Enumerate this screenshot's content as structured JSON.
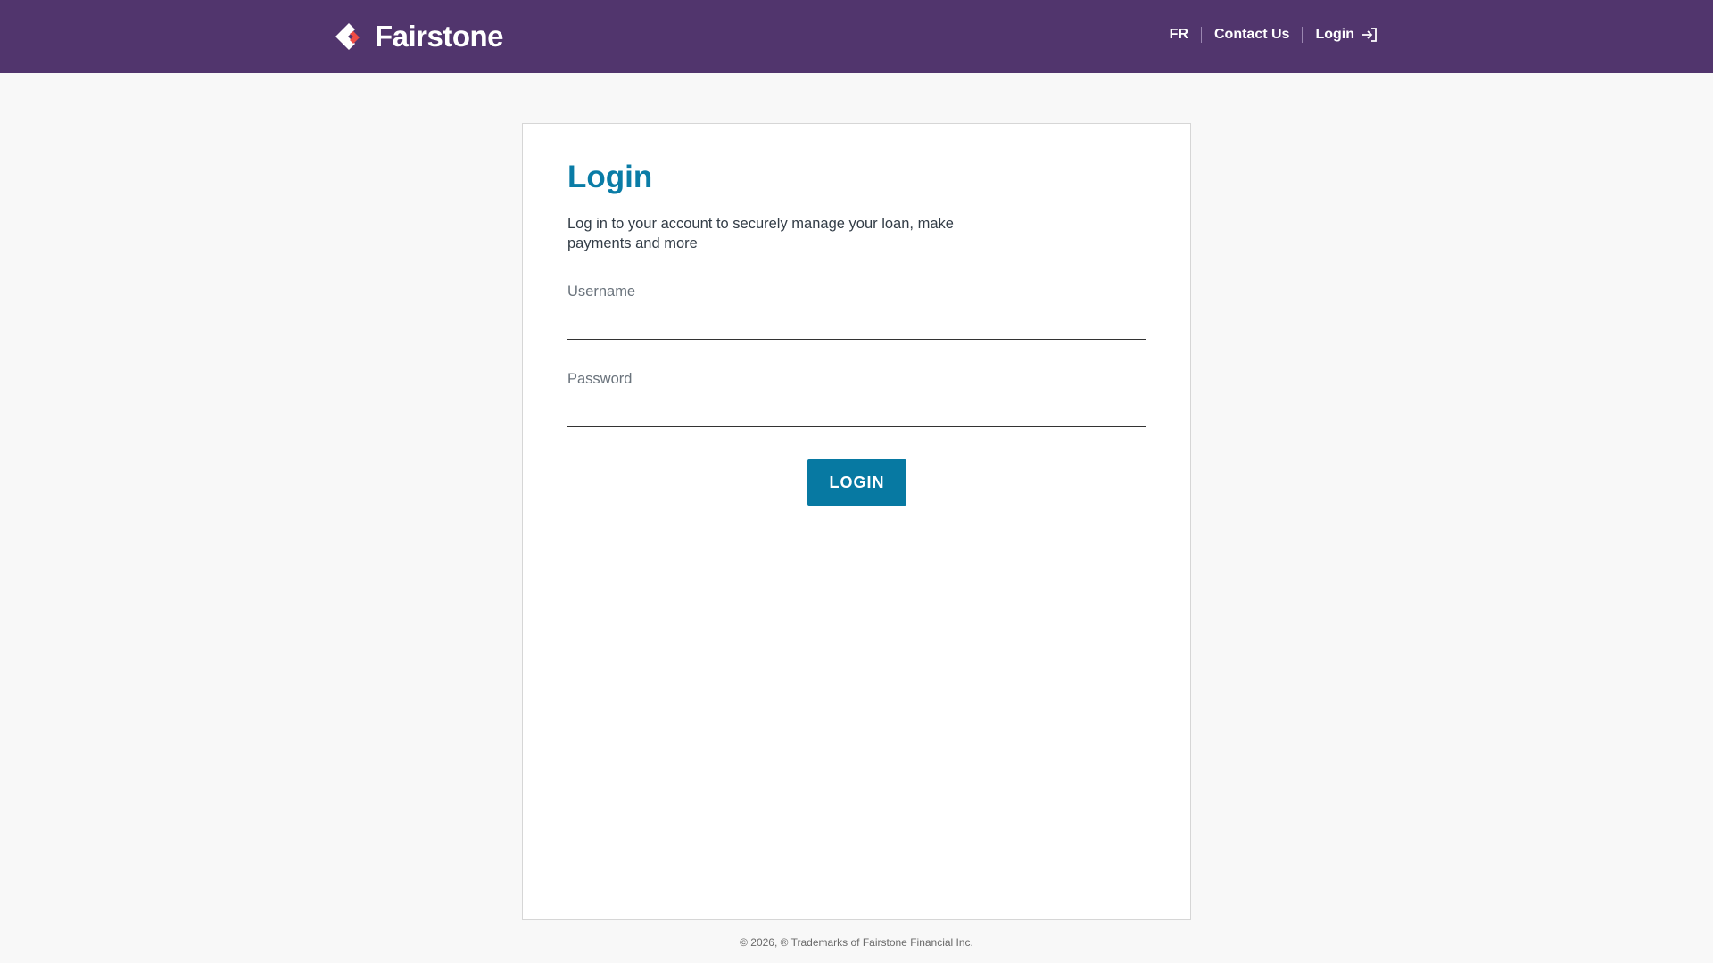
{
  "header": {
    "brand": "Fairstone",
    "nav": {
      "lang": "FR",
      "contact": "Contact Us",
      "login": "Login"
    }
  },
  "colors": {
    "header": "#51356d",
    "accent": "#0a7ca6",
    "button": "#0779a2",
    "logo_red": "#ee4c45"
  },
  "card": {
    "title": "Login",
    "description": "Log in to your account to securely manage your loan, make payments and more",
    "username_label": "Username",
    "username_value": "",
    "password_label": "Password",
    "password_value": "",
    "submit": "LOGIN"
  },
  "footer": {
    "text": "© 2026, ® Trademarks of Fairstone Financial Inc."
  }
}
